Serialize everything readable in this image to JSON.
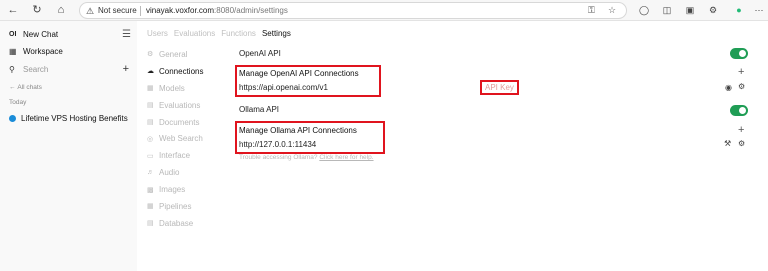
{
  "browser": {
    "security_label": "Not secure",
    "url_host": "vinayak.voxfor.com",
    "url_rest": ":8080/admin/settings"
  },
  "sidebar": {
    "logo": "OI",
    "new_chat": "New Chat",
    "workspace": "Workspace",
    "search_placeholder": "Search",
    "all_chats": "All chats",
    "today": "Today",
    "chats": [
      {
        "title": "Lifetime VPS Hosting Benefits",
        "color": "#1a8cd8"
      }
    ]
  },
  "tabs": [
    {
      "label": "Users"
    },
    {
      "label": "Evaluations"
    },
    {
      "label": "Functions"
    },
    {
      "label": "Settings",
      "active": true
    }
  ],
  "settings_nav": [
    {
      "label": "General",
      "icon": "gear-icon"
    },
    {
      "label": "Connections",
      "icon": "cloud-icon",
      "active": true
    },
    {
      "label": "Models",
      "icon": "models-icon"
    },
    {
      "label": "Evaluations",
      "icon": "document-icon"
    },
    {
      "label": "Documents",
      "icon": "document-icon"
    },
    {
      "label": "Web Search",
      "icon": "globe-icon"
    },
    {
      "label": "Interface",
      "icon": "monitor-icon"
    },
    {
      "label": "Audio",
      "icon": "speaker-icon"
    },
    {
      "label": "Images",
      "icon": "image-icon"
    },
    {
      "label": "Pipelines",
      "icon": "pipeline-icon"
    },
    {
      "label": "Database",
      "icon": "database-icon"
    }
  ],
  "openai": {
    "title": "OpenAI API",
    "enabled": true,
    "manage_label": "Manage OpenAI API Connections",
    "url": "https://api.openai.com/v1",
    "api_key_placeholder": "API Key"
  },
  "ollama": {
    "title": "Ollama API",
    "enabled": true,
    "manage_label": "Manage Ollama API Connections",
    "url": "http://127.0.0.1:11434",
    "help_text": "Trouble accessing Ollama?",
    "help_link": "Click here for help."
  },
  "colors": {
    "toggle_on": "#1f9d55",
    "highlight_box": "#e0141e",
    "chat_dot": "#1a8cd8"
  }
}
